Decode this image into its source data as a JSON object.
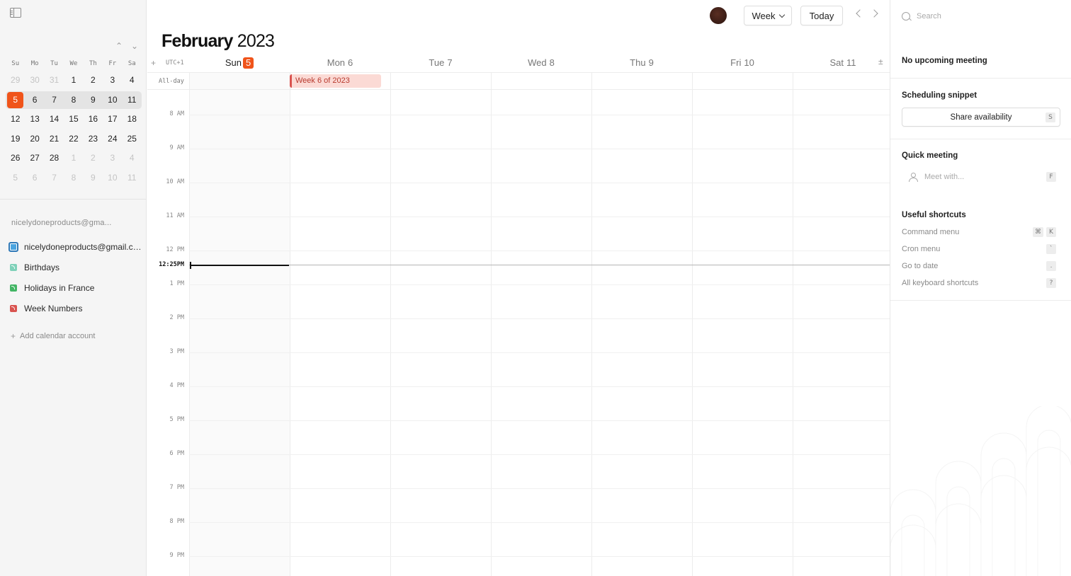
{
  "mini_calendar": {
    "weekday_headers": [
      "Su",
      "Mo",
      "Tu",
      "We",
      "Th",
      "Fr",
      "Sa"
    ],
    "weeks": [
      [
        {
          "d": "29",
          "m": true
        },
        {
          "d": "30",
          "m": true
        },
        {
          "d": "31",
          "m": true
        },
        {
          "d": "1"
        },
        {
          "d": "2"
        },
        {
          "d": "3"
        },
        {
          "d": "4"
        }
      ],
      [
        {
          "d": "5",
          "t": true
        },
        {
          "d": "6"
        },
        {
          "d": "7"
        },
        {
          "d": "8"
        },
        {
          "d": "9"
        },
        {
          "d": "10"
        },
        {
          "d": "11"
        }
      ],
      [
        {
          "d": "12"
        },
        {
          "d": "13"
        },
        {
          "d": "14"
        },
        {
          "d": "15"
        },
        {
          "d": "16"
        },
        {
          "d": "17"
        },
        {
          "d": "18"
        }
      ],
      [
        {
          "d": "19"
        },
        {
          "d": "20"
        },
        {
          "d": "21"
        },
        {
          "d": "22"
        },
        {
          "d": "23"
        },
        {
          "d": "24"
        },
        {
          "d": "25"
        }
      ],
      [
        {
          "d": "26"
        },
        {
          "d": "27"
        },
        {
          "d": "28"
        },
        {
          "d": "1",
          "m": true
        },
        {
          "d": "2",
          "m": true
        },
        {
          "d": "3",
          "m": true
        },
        {
          "d": "4",
          "m": true
        }
      ],
      [
        {
          "d": "5",
          "m": true
        },
        {
          "d": "6",
          "m": true
        },
        {
          "d": "7",
          "m": true
        },
        {
          "d": "8",
          "m": true
        },
        {
          "d": "9",
          "m": true
        },
        {
          "d": "10",
          "m": true
        },
        {
          "d": "11",
          "m": true
        }
      ]
    ],
    "highlighted_week_index": 1,
    "prev_icon": "chevron-up-icon",
    "next_icon": "chevron-down-icon",
    "prev_glyph": "⌃",
    "next_glyph": "⌄"
  },
  "sidebar": {
    "account_label": "nicelydoneproducts@gma...",
    "calendars": [
      {
        "name": "nicelydoneproducts@gmail.com",
        "style": "blue",
        "kind": "checkbox"
      },
      {
        "name": "Birthdays",
        "style": "teal",
        "kind": "feed"
      },
      {
        "name": "Holidays in France",
        "style": "green",
        "kind": "feed"
      },
      {
        "name": "Week Numbers",
        "style": "red",
        "kind": "feed"
      }
    ],
    "add_account_label": "Add calendar account",
    "add_glyph": "+"
  },
  "header": {
    "month": "February",
    "year": "2023",
    "view_label": "Week",
    "today_label": "Today"
  },
  "week": {
    "add_glyph": "+",
    "timezone": "UTC+1",
    "zoom_glyph": "±",
    "days": [
      {
        "name": "Sun",
        "num": "5",
        "current": true
      },
      {
        "name": "Mon",
        "num": "6"
      },
      {
        "name": "Tue",
        "num": "7"
      },
      {
        "name": "Wed",
        "num": "8"
      },
      {
        "name": "Thu",
        "num": "9"
      },
      {
        "name": "Fri",
        "num": "10"
      },
      {
        "name": "Sat",
        "num": "11"
      }
    ],
    "all_day_label": "All-day",
    "all_day_event": "Week 6 of 2023",
    "hours": [
      "8 AM",
      "9 AM",
      "10 AM",
      "11 AM",
      "12 PM",
      "1 PM",
      "2 PM",
      "3 PM",
      "4 PM",
      "5 PM",
      "6 PM",
      "7 PM",
      "8 PM",
      "9 PM"
    ],
    "first_hour": 8,
    "current_time_label": "12:25PM",
    "current_time_hours": 12.4167
  },
  "right_panel": {
    "search_placeholder": "Search",
    "no_meeting": "No upcoming meeting",
    "scheduling_title": "Scheduling snippet",
    "share_label": "Share availability",
    "share_key": "S",
    "quick_title": "Quick meeting",
    "meet_placeholder": "Meet with...",
    "meet_key": "F",
    "shortcuts_title": "Useful shortcuts",
    "shortcuts": [
      {
        "label": "Command menu",
        "keys": [
          "⌘",
          "K"
        ]
      },
      {
        "label": "Cron menu",
        "keys": [
          "`"
        ]
      },
      {
        "label": "Go to date",
        "keys": [
          "."
        ]
      },
      {
        "label": "All keyboard shortcuts",
        "keys": [
          "?"
        ]
      }
    ]
  },
  "colors": {
    "accent": "#f0541a",
    "event_bg": "#fbdad5",
    "event_border": "#d9534f"
  }
}
